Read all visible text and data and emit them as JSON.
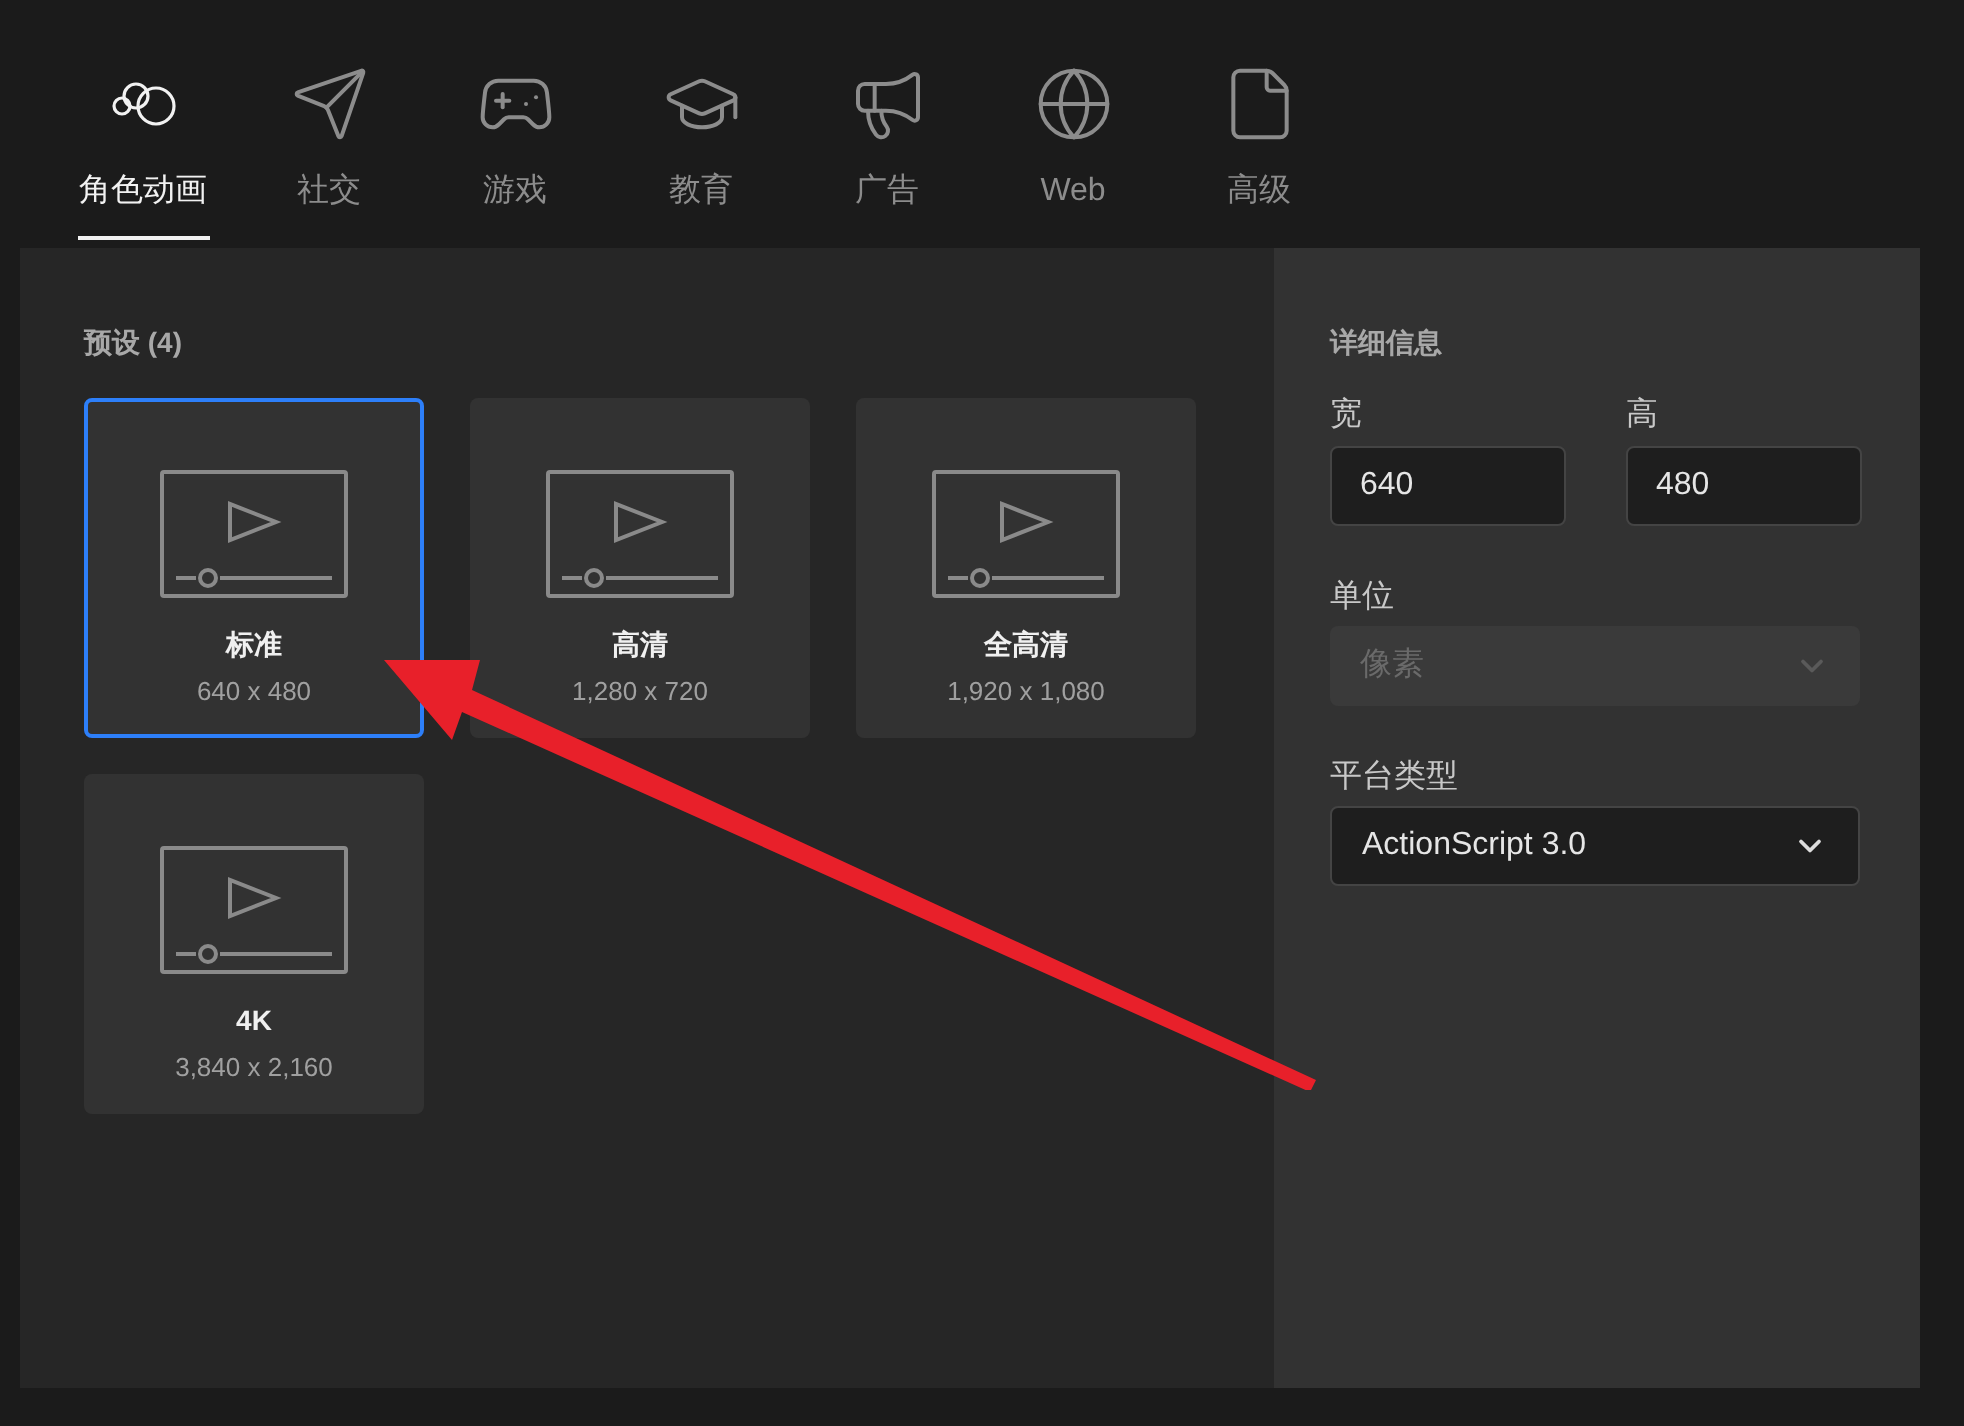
{
  "tabs": [
    {
      "label": "角色动画",
      "selected": true
    },
    {
      "label": "社交",
      "selected": false
    },
    {
      "label": "游戏",
      "selected": false
    },
    {
      "label": "教育",
      "selected": false
    },
    {
      "label": "广告",
      "selected": false
    },
    {
      "label": "Web",
      "selected": false
    },
    {
      "label": "高级",
      "selected": false
    }
  ],
  "presets": {
    "heading": "预设 (4)",
    "items": [
      {
        "name": "标准",
        "size": "640 x 480",
        "selected": true
      },
      {
        "name": "高清",
        "size": "1,280 x 720",
        "selected": false
      },
      {
        "name": "全高清",
        "size": "1,920 x 1,080",
        "selected": false
      },
      {
        "name": "4K",
        "size": "3,840 x 2,160",
        "selected": false
      }
    ]
  },
  "details": {
    "heading": "详细信息",
    "width": {
      "label": "宽",
      "value": "640"
    },
    "height": {
      "label": "高",
      "value": "480"
    },
    "unit": {
      "label": "单位",
      "value": "像素",
      "disabled": true
    },
    "platform": {
      "label": "平台类型",
      "value": "ActionScript 3.0",
      "disabled": false
    }
  }
}
